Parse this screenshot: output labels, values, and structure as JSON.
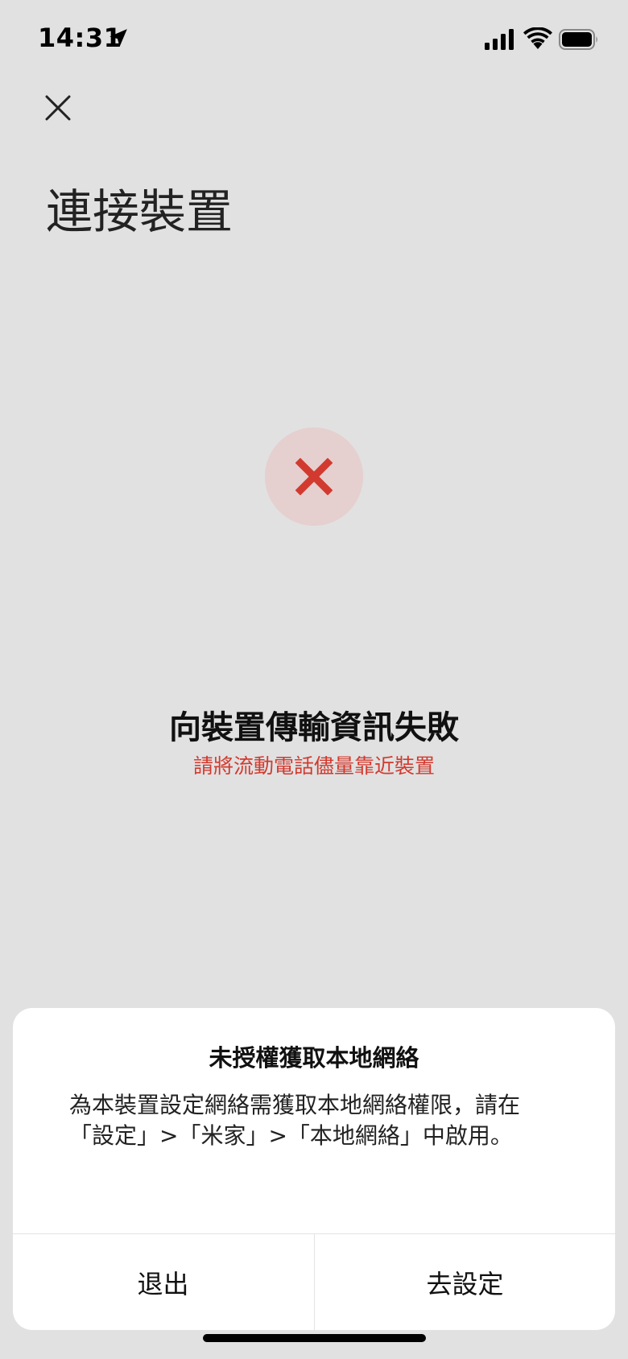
{
  "status_bar": {
    "time": "14:31",
    "icons": [
      "location-arrow-icon",
      "cellular-signal-icon",
      "wifi-icon",
      "battery-icon"
    ]
  },
  "header": {
    "close_icon": "close-icon",
    "title": "連接裝置"
  },
  "status": {
    "icon": "error-x-icon",
    "title": "向裝置傳輸資訊失敗",
    "hint": "請將流動電話儘量靠近裝置"
  },
  "dialog": {
    "title": "未授權獲取本地網絡",
    "message": "為本裝置設定網絡需獲取本地網絡權限，請在「設定」>「米家」>「本地網絡」中啟用。",
    "cancel_label": "退出",
    "confirm_label": "去設定"
  },
  "colors": {
    "background": "#e1e1e1",
    "error_red": "#d23a2f",
    "error_circle_bg": "#e5cfcf",
    "dialog_bg": "#ffffff"
  }
}
